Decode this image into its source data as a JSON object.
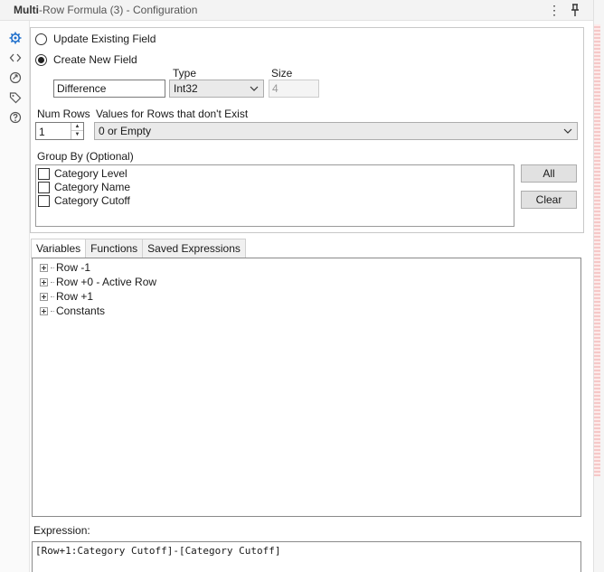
{
  "window": {
    "title_bold": "Multi",
    "title_rest": "-Row Formula (3) - Configuration",
    "menu_glyph": "⋮"
  },
  "left_toolbar": {
    "icons": [
      "gear-icon",
      "code-brackets-icon",
      "annotation-icon",
      "tag-icon",
      "help-icon"
    ],
    "active_color": "#1e6fcc"
  },
  "config": {
    "radio_update": "Update Existing Field",
    "radio_create": "Create New  Field",
    "selected": "create",
    "type_label": "Type",
    "size_label": "Size",
    "field_name": "Difference",
    "type_value": "Int32",
    "size_value": "4",
    "num_rows_label": "Num Rows",
    "num_rows_value": "1",
    "nonexist_label": "Values for Rows that don't Exist",
    "nonexist_value": "0 or Empty",
    "group_by_label": "Group By (Optional)",
    "group_fields": [
      "Category Level",
      "Category Name",
      "Category Cutoff"
    ],
    "all_button": "All",
    "clear_button": "Clear"
  },
  "tabs": [
    "Variables",
    "Functions",
    "Saved Expressions"
  ],
  "active_tab": "Variables",
  "tree": [
    "Row -1",
    "Row +0 - Active Row",
    "Row +1",
    "Constants"
  ],
  "expression": {
    "label": "Expression:",
    "value": "[Row+1:Category Cutoff]-[Category Cutoff]"
  }
}
